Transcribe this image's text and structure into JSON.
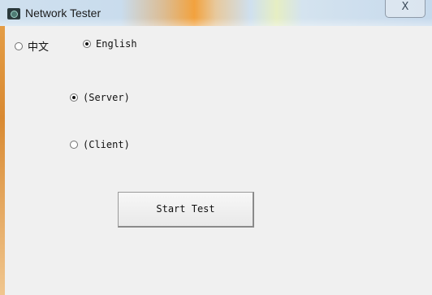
{
  "window": {
    "title": "Network Tester",
    "close_label": "X"
  },
  "language": {
    "options": [
      {
        "label": "中文",
        "checked": false
      },
      {
        "label": "English",
        "checked": true
      }
    ]
  },
  "mode": {
    "options": [
      {
        "label": "(Server)",
        "checked": true
      },
      {
        "label": "(Client)",
        "checked": false
      }
    ]
  },
  "actions": {
    "start_label": "Start Test"
  }
}
